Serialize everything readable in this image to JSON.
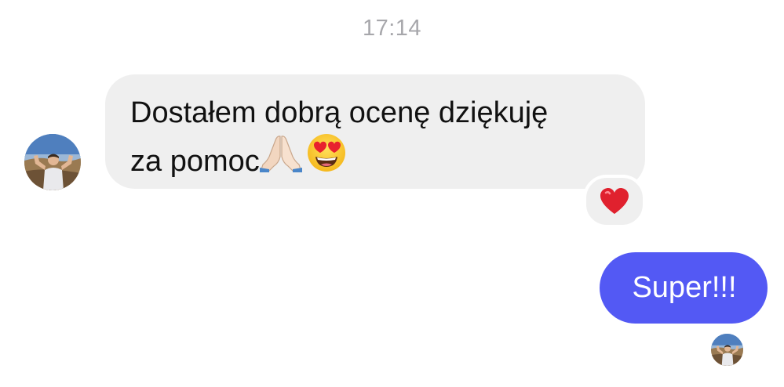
{
  "timestamp": "17:14",
  "incoming_message": {
    "line1": "Dostałem dobrą ocenę dziękuję",
    "line2": "za pomoc",
    "emojis": [
      "folded-hands-icon",
      "heart-eyes-face-icon"
    ],
    "reaction": "heart-icon"
  },
  "outgoing_message": {
    "text": "Super!!!"
  },
  "colors": {
    "incoming_bubble": "#efefef",
    "outgoing_bubble": "#5359f4",
    "timestamp_text": "#a7a7ab",
    "reaction_heart": "#e0212e"
  }
}
